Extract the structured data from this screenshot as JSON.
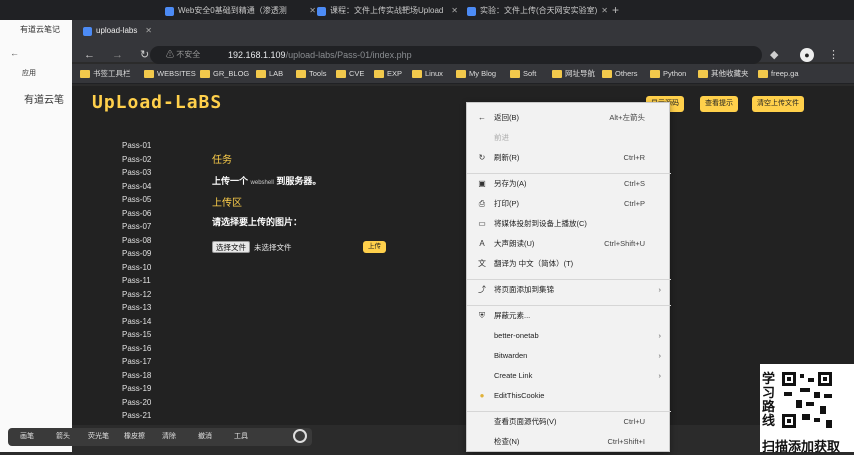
{
  "tabs": [
    {
      "label": "有道云笔记"
    },
    {
      "label": "Web安全0基础到精通（渗透测"
    },
    {
      "label": "课程：文件上传实战靶场Upload"
    },
    {
      "label": "实验：文件上传(合天网安实验室)"
    },
    {
      "label": "upload-labs"
    }
  ],
  "toolbar": {
    "url_host": "192.168.1.109",
    "url_path": "/upload-labs/Pass-01/index.php",
    "new_tab": "+",
    "security": "不安全"
  },
  "left_window": {
    "title": "有道云笔记",
    "app_label": "有道云笔",
    "bookmark_label": "应用"
  },
  "bookmarks": [
    "书签工具栏",
    "WEBSITES",
    "GR_BLOG",
    "LAB",
    "Tools",
    "CVE",
    "EXP",
    "Linux",
    "My Blog",
    "Soft",
    "网址导航",
    "Others",
    "Python",
    "其他收藏夹",
    "freep.ga"
  ],
  "page": {
    "logo": "UpLoad-LaBS",
    "top_buttons": [
      "显示源码",
      "查看提示",
      "清空上传文件"
    ],
    "passes": [
      "Pass-01",
      "Pass-02",
      "Pass-03",
      "Pass-04",
      "Pass-05",
      "Pass-06",
      "Pass-07",
      "Pass-08",
      "Pass-09",
      "Pass-10",
      "Pass-11",
      "Pass-12",
      "Pass-13",
      "Pass-14",
      "Pass-15",
      "Pass-16",
      "Pass-17",
      "Pass-18",
      "Pass-19",
      "Pass-20",
      "Pass-21"
    ],
    "task_heading": "任务",
    "task_text": "上传一个",
    "task_file": "webshell",
    "task_suffix": "到服务器。",
    "area_heading": "上传区",
    "area_text": "请选择要上传的图片：",
    "choose_label": "选择文件",
    "no_file": "未选择文件",
    "upload_label": "上传"
  },
  "context_menu": [
    {
      "icon": "back-arrow",
      "label": "返回(B)",
      "shortcut": "Alt+左箭头"
    },
    {
      "icon": "",
      "label": "前进",
      "shortcut": "",
      "disabled": true
    },
    {
      "icon": "reload",
      "label": "刷新(R)",
      "shortcut": "Ctrl+R"
    },
    {
      "sep": true
    },
    {
      "icon": "save",
      "label": "另存为(A)",
      "shortcut": "Ctrl+S"
    },
    {
      "icon": "print",
      "label": "打印(P)",
      "shortcut": "Ctrl+P"
    },
    {
      "icon": "cast",
      "label": "将媒体投射到设备上播放(C)",
      "shortcut": ""
    },
    {
      "icon": "read-aloud",
      "label": "大声朗读(U)",
      "shortcut": "Ctrl+Shift+U"
    },
    {
      "icon": "translate",
      "label": "翻译为 中文（简体）(T)",
      "shortcut": ""
    },
    {
      "sep": true
    },
    {
      "icon": "share",
      "label": "将页面添加到集锦",
      "shortcut": "",
      "arrow": true
    },
    {
      "sep": true
    },
    {
      "icon": "shield",
      "label": "屏蔽元素...",
      "shortcut": ""
    },
    {
      "icon": "",
      "label": "better-onetab",
      "shortcut": "",
      "arrow": true
    },
    {
      "icon": "",
      "label": "Bitwarden",
      "shortcut": "",
      "arrow": true
    },
    {
      "icon": "",
      "label": "Create Link",
      "shortcut": "",
      "arrow": true
    },
    {
      "icon": "cookie",
      "label": "EditThisCookie",
      "shortcut": ""
    },
    {
      "sep": true
    },
    {
      "icon": "",
      "label": "查看页面源代码(V)",
      "shortcut": "Ctrl+U"
    },
    {
      "icon": "",
      "label": "检查(N)",
      "shortcut": "Ctrl+Shift+I"
    }
  ],
  "taskbar": [
    "画笔",
    "箭头",
    "荧光笔",
    "橡皮擦",
    "清除",
    "撤消",
    "工具"
  ],
  "ad": {
    "side_text": "学习路线",
    "bottom_text": "扫描添加获取"
  },
  "colors": {
    "accent": "#ffd04b",
    "page_bg": "#222222",
    "menu_bg": "#f2f2f2"
  }
}
